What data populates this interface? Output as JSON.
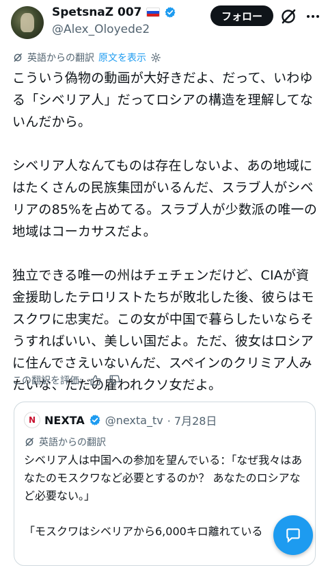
{
  "author": {
    "name": "SpetsnaZ 007",
    "handle": "@Alex_Oloyede2",
    "flag_icon": "russia-flag-icon"
  },
  "header": {
    "follow_label": "フォロー",
    "grok_icon": "grok-icon",
    "more_icon": "more-icon"
  },
  "translation": {
    "label": "英語からの翻訳",
    "show_original": "原文を表示"
  },
  "tweet": {
    "paragraphs": [
      "こういう偽物の動画が大好きだよ、だって、いわゆる「シベリア人」だってロシアの構造を理解してないんだから。",
      "シベリア人なんてものは存在しないよ、あの地域にはたくさんの民族集団がいるんだ、スラブ人がシベリアの85%を占めてる。スラブ人が少数派の唯一の地域はコーカサスだよ。",
      "独立できる唯一の州はチェチェンだけど、CIAが資金援助したテロリストたちが敗北した後、彼らはモスクワに忠実だ。この女が中国で暮らしたいならそうすればいい、美しい国だよ。ただ、彼女はロシアに住んでさえいないんだ、スペインのクリミア人みたいな、ただの雇われクソ女だよ。"
    ]
  },
  "rate": {
    "label": "この翻訳を評価:"
  },
  "quote": {
    "logo_text": "N",
    "name": "NEXTA",
    "handle": "@nexta_tv",
    "date": "· 7月28日",
    "translation_label": "英語からの翻訳",
    "paragraphs": [
      "シベリア人は中国への参加を望んでいる：「なぜ我々はあなたのモスクワなど必要とするのか？ あなたのロシアなど必要ない。」",
      "「モスクワはシベリアから6,000キロ離れている"
    ]
  },
  "colors": {
    "accent": "#1d9bf0",
    "text": "#0f1419",
    "secondary": "#536471"
  }
}
